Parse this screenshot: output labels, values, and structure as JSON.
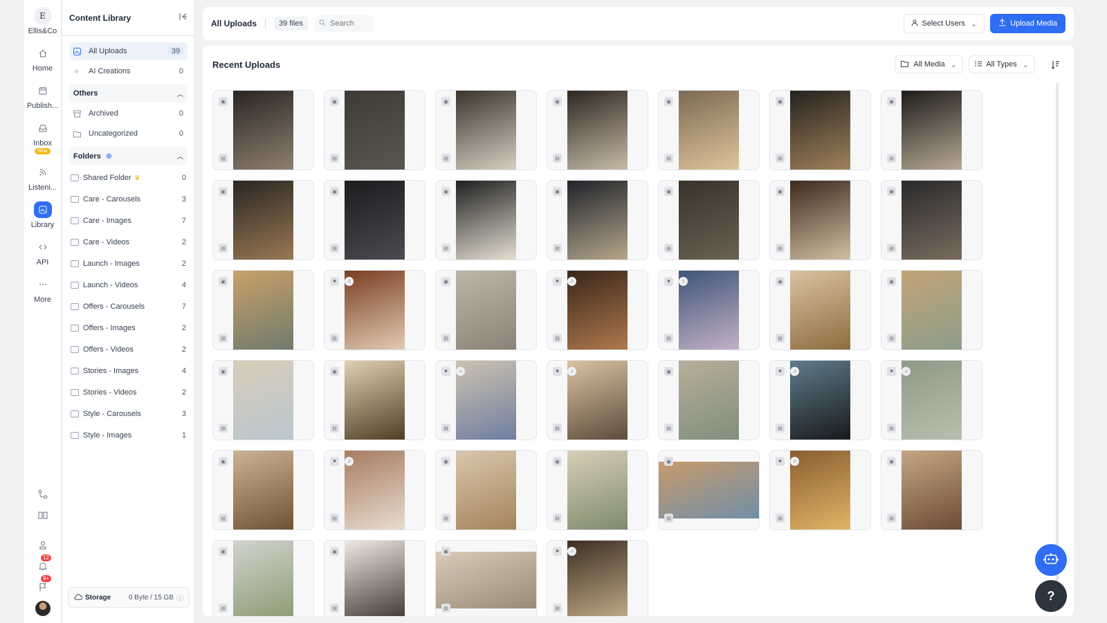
{
  "workspace": {
    "logo_letter": "E",
    "name": "Ellis&Co"
  },
  "rail": [
    {
      "label": "Home",
      "icon": "home-icon"
    },
    {
      "label": "Publish...",
      "icon": "calendar-icon"
    },
    {
      "label": "Inbox",
      "icon": "inbox-icon",
      "badge": "New"
    },
    {
      "label": "Listeni...",
      "icon": "rss-icon"
    },
    {
      "label": "Library",
      "icon": "library-icon",
      "active": true
    },
    {
      "label": "API",
      "icon": "code-icon"
    },
    {
      "label": "More",
      "icon": "more-icon"
    }
  ],
  "rail_bottom": {
    "notifications_count": "12",
    "messages_count": "9+"
  },
  "library": {
    "title": "Content Library",
    "main_items": [
      {
        "label": "All Uploads",
        "count": "39"
      },
      {
        "label": "AI Creations",
        "count": "0"
      }
    ],
    "others_label": "Others",
    "others": [
      {
        "label": "Archived",
        "count": "0"
      },
      {
        "label": "Uncategorized",
        "count": "0"
      }
    ],
    "folders_label": "Folders",
    "folders": [
      {
        "label": "Shared Folder",
        "count": "0",
        "crown": true
      },
      {
        "label": "Care - Carousels",
        "count": "3"
      },
      {
        "label": "Care - Images",
        "count": "7"
      },
      {
        "label": "Care - Videos",
        "count": "2"
      },
      {
        "label": "Launch - Images",
        "count": "2"
      },
      {
        "label": "Launch - Videos",
        "count": "4"
      },
      {
        "label": "Offers - Carousels",
        "count": "7"
      },
      {
        "label": "Offers - Images",
        "count": "2"
      },
      {
        "label": "Offers - Videos",
        "count": "2"
      },
      {
        "label": "Stories - Images",
        "count": "4"
      },
      {
        "label": "Stories - Videos",
        "count": "2"
      },
      {
        "label": "Style - Carousels",
        "count": "3"
      },
      {
        "label": "Style - Images",
        "count": "1"
      }
    ],
    "storage_label": "Storage",
    "storage_value": "0 Byte / 15 GB"
  },
  "topbar": {
    "title": "All Uploads",
    "file_count": "39 files",
    "search_placeholder": "Search",
    "select_users": "Select Users",
    "upload_label": "Upload Media"
  },
  "main": {
    "title": "Recent Uploads",
    "filter_media": "All Media",
    "filter_types": "All Types"
  },
  "thumbnails": [
    {
      "type": "image",
      "colors": [
        "#2b2622",
        "#8f8070"
      ]
    },
    {
      "type": "image",
      "colors": [
        "#3e3b36",
        "#5b574f"
      ]
    },
    {
      "type": "image",
      "colors": [
        "#3a342c",
        "#d8d0c2"
      ]
    },
    {
      "type": "image",
      "colors": [
        "#2e2620",
        "#c9bda8"
      ]
    },
    {
      "type": "image",
      "colors": [
        "#7b6a52",
        "#e0c69d"
      ]
    },
    {
      "type": "image",
      "colors": [
        "#26221e",
        "#a0835c"
      ]
    },
    {
      "type": "image",
      "colors": [
        "#1e1c1a",
        "#b9aa96"
      ]
    },
    {
      "type": "image",
      "colors": [
        "#2a2622",
        "#9a7a55"
      ]
    },
    {
      "type": "image",
      "colors": [
        "#1c1c1e",
        "#4b4c52"
      ]
    },
    {
      "type": "image",
      "colors": [
        "#1f1f1f",
        "#e9e2d4"
      ]
    },
    {
      "type": "image",
      "colors": [
        "#20232a",
        "#b7a88c"
      ]
    },
    {
      "type": "image",
      "colors": [
        "#3a3128",
        "#6b6255"
      ]
    },
    {
      "type": "image",
      "colors": [
        "#3b2a1e",
        "#d2c2a4"
      ]
    },
    {
      "type": "image",
      "colors": [
        "#2a2a2c",
        "#7b6c5e"
      ]
    },
    {
      "type": "image",
      "colors": [
        "#c9a06a",
        "#6f7a6c"
      ]
    },
    {
      "type": "video",
      "colors": [
        "#7a3e22",
        "#e3cdb5"
      ]
    },
    {
      "type": "image",
      "colors": [
        "#bdb6a8",
        "#8a8276"
      ]
    },
    {
      "type": "video",
      "colors": [
        "#3a261a",
        "#b07a4e"
      ]
    },
    {
      "type": "video",
      "colors": [
        "#3d5577",
        "#c6b2c8"
      ]
    },
    {
      "type": "image",
      "colors": [
        "#d9c3a0",
        "#8d6b3e"
      ]
    },
    {
      "type": "image",
      "colors": [
        "#c2a477",
        "#8d9d8b"
      ]
    },
    {
      "type": "image",
      "colors": [
        "#d8cdb8",
        "#b9c6cf"
      ]
    },
    {
      "type": "image",
      "colors": [
        "#e0d0b4",
        "#4e3b24"
      ]
    },
    {
      "type": "video",
      "colors": [
        "#ccc2b0",
        "#6e7ea0"
      ]
    },
    {
      "type": "video",
      "colors": [
        "#d9c3a4",
        "#5c4a3a"
      ]
    },
    {
      "type": "image",
      "colors": [
        "#b8ad9a",
        "#7f8f7c"
      ]
    },
    {
      "type": "video",
      "colors": [
        "#607c8a",
        "#16181c"
      ]
    },
    {
      "type": "video",
      "colors": [
        "#8e9a86",
        "#b9bfae"
      ]
    },
    {
      "type": "image",
      "colors": [
        "#cbb493",
        "#6b5233"
      ]
    },
    {
      "type": "video",
      "colors": [
        "#a77c62",
        "#e9ddd1"
      ]
    },
    {
      "type": "image",
      "colors": [
        "#d8c7ad",
        "#a4835a"
      ]
    },
    {
      "type": "image",
      "colors": [
        "#d9cdb9",
        "#7c8a6e"
      ]
    },
    {
      "type": "image",
      "colors": [
        "#c89a6c",
        "#6f8fa8"
      ],
      "wide": true
    },
    {
      "type": "video",
      "colors": [
        "#8a5d2f",
        "#e0b768"
      ]
    },
    {
      "type": "image",
      "colors": [
        "#c5a683",
        "#6b4a34"
      ]
    },
    {
      "type": "image",
      "colors": [
        "#cfd4cc",
        "#8c9a73"
      ]
    },
    {
      "type": "image",
      "colors": [
        "#efe9e2",
        "#3e3630"
      ]
    },
    {
      "type": "image",
      "colors": [
        "#d8cbb8",
        "#9a8a78"
      ],
      "wide": true
    },
    {
      "type": "video",
      "colors": [
        "#3b2e22",
        "#c4ad8a"
      ]
    }
  ],
  "colors": {
    "accent": "#2f6ef2",
    "fab_bot": "#2f6ef2",
    "fab_help": "#2c3440"
  }
}
